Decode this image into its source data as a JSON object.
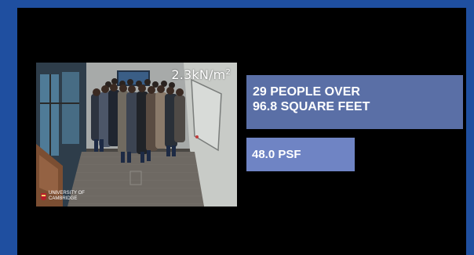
{
  "photo": {
    "overlay_value": "2.3kN/m",
    "overlay_exponent": "2",
    "logo": {
      "line1": "UNIVERSITY OF",
      "line2": "CAMBRIDGE"
    }
  },
  "info": {
    "box1_line1": "29 PEOPLE OVER",
    "box1_line2": "96.8 SQUARE FEET",
    "box2": "48.0 PSF"
  },
  "colors": {
    "frame": "#1f4fa0",
    "stage": "#000000",
    "box1": "#5a6fa6",
    "box2": "#6f84c4"
  }
}
